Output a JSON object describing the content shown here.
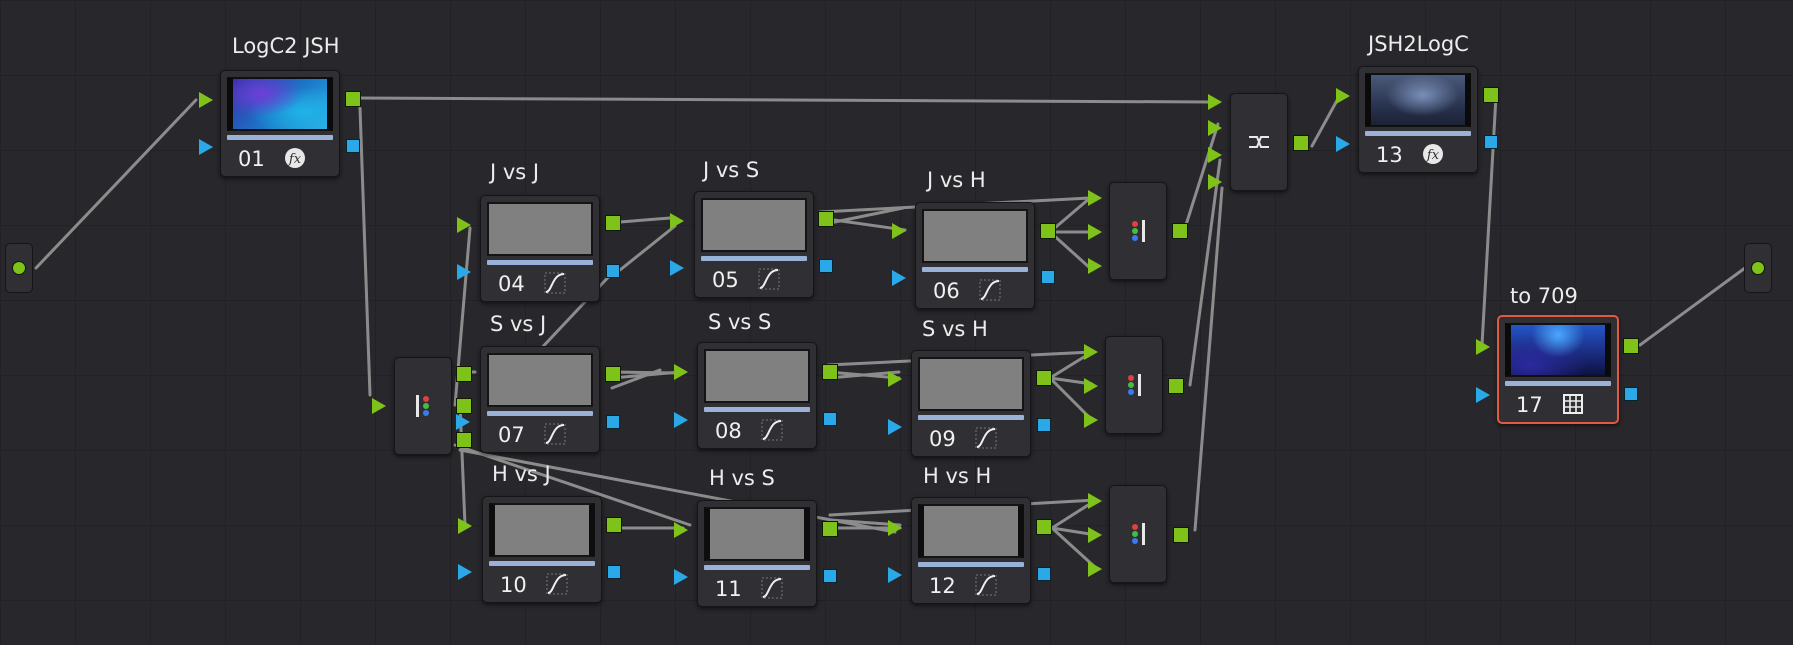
{
  "colors": {
    "background": "#28282c",
    "node_bg": "#303034",
    "wire": "#8c8c8c",
    "rgb_port": "#7fc31a",
    "alpha_port": "#2aa8e8",
    "selected_border": "#e05a40"
  },
  "nodes": {
    "n01": {
      "label": "LogC2 JSH",
      "number": "01",
      "icon": "fx-icon"
    },
    "n04": {
      "label": "J vs J",
      "number": "04",
      "icon": "curve-icon"
    },
    "n05": {
      "label": "J vs S",
      "number": "05",
      "icon": "curve-icon"
    },
    "n06": {
      "label": "J vs H",
      "number": "06",
      "icon": "curve-icon"
    },
    "n07": {
      "label": "S vs J",
      "number": "07",
      "icon": "curve-icon"
    },
    "n08": {
      "label": "S vs S",
      "number": "08",
      "icon": "curve-icon"
    },
    "n09": {
      "label": "S vs H",
      "number": "09",
      "icon": "curve-icon"
    },
    "n10": {
      "label": "H vs J",
      "number": "10",
      "icon": "curve-icon"
    },
    "n11": {
      "label": "H vs S",
      "number": "11",
      "icon": "curve-icon"
    },
    "n12": {
      "label": "H vs H",
      "number": "12",
      "icon": "curve-icon"
    },
    "n13": {
      "label": "JSH2LogC",
      "number": "13",
      "icon": "fx-icon"
    },
    "n17": {
      "label": "to 709",
      "number": "17",
      "icon": "lut-grid-icon",
      "selected": true
    }
  },
  "special_nodes": {
    "splitter": "splitter-node",
    "combiners": [
      "combiner-node",
      "combiner-node",
      "combiner-node"
    ],
    "layer_mixer": "layer-mixer-node",
    "source": "source-input-node",
    "output": "output-node"
  }
}
